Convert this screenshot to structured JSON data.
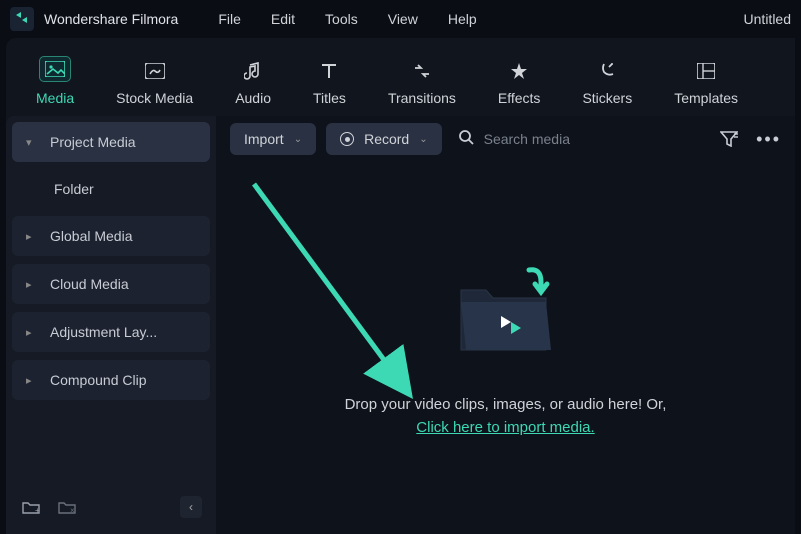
{
  "app": {
    "name": "Wondershare Filmora",
    "doc_title": "Untitled"
  },
  "menu": {
    "file": "File",
    "edit": "Edit",
    "tools": "Tools",
    "view": "View",
    "help": "Help"
  },
  "topnav": {
    "media": "Media",
    "stock_media": "Stock Media",
    "audio": "Audio",
    "titles": "Titles",
    "transitions": "Transitions",
    "effects": "Effects",
    "stickers": "Stickers",
    "templates": "Templates"
  },
  "sidebar": {
    "project_media": "Project Media",
    "folder": "Folder",
    "global_media": "Global Media",
    "cloud_media": "Cloud Media",
    "adjustment_layer": "Adjustment Lay...",
    "compound_clip": "Compound Clip"
  },
  "toolbar": {
    "import_label": "Import",
    "record_label": "Record",
    "search_placeholder": "Search media"
  },
  "dropzone": {
    "text": "Drop your video clips, images, or audio here! Or,",
    "link": "Click here to import media."
  },
  "colors": {
    "accent": "#3dd9b5",
    "bg": "#0a0d14",
    "panel": "#151a24"
  }
}
